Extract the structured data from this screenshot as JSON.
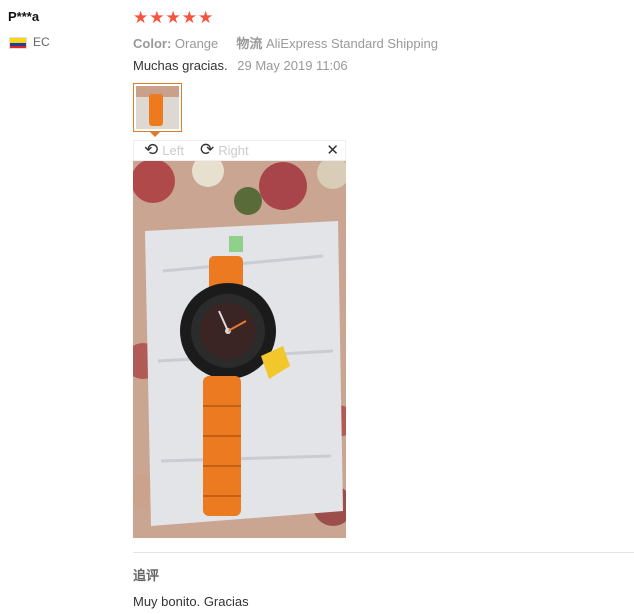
{
  "reviewer": {
    "name": "P***a",
    "country_code": "EC",
    "flag_colors": [
      "#f9d616",
      "#1f3f9e",
      "#d62828"
    ]
  },
  "rating": {
    "stars_text": "★★★★★",
    "value": 5,
    "max": 5,
    "color": "#f5543e"
  },
  "meta": {
    "color_label": "Color:",
    "color_value": "Orange",
    "shipping_label": "物流",
    "shipping_value": "AliExpress Standard Shipping"
  },
  "review": {
    "text": "Muchas gracias.",
    "date": "29 May 2019 11:06"
  },
  "viewer": {
    "rotate_left_label": "Left",
    "rotate_right_label": "Right",
    "rotate_left_icon": "rotate-ccw-icon",
    "rotate_right_icon": "rotate-cw-icon",
    "close_icon": "close-icon",
    "accent_color": "#e07b2a"
  },
  "followup": {
    "label": "追评",
    "text": "Muy bonito. Gracias"
  }
}
